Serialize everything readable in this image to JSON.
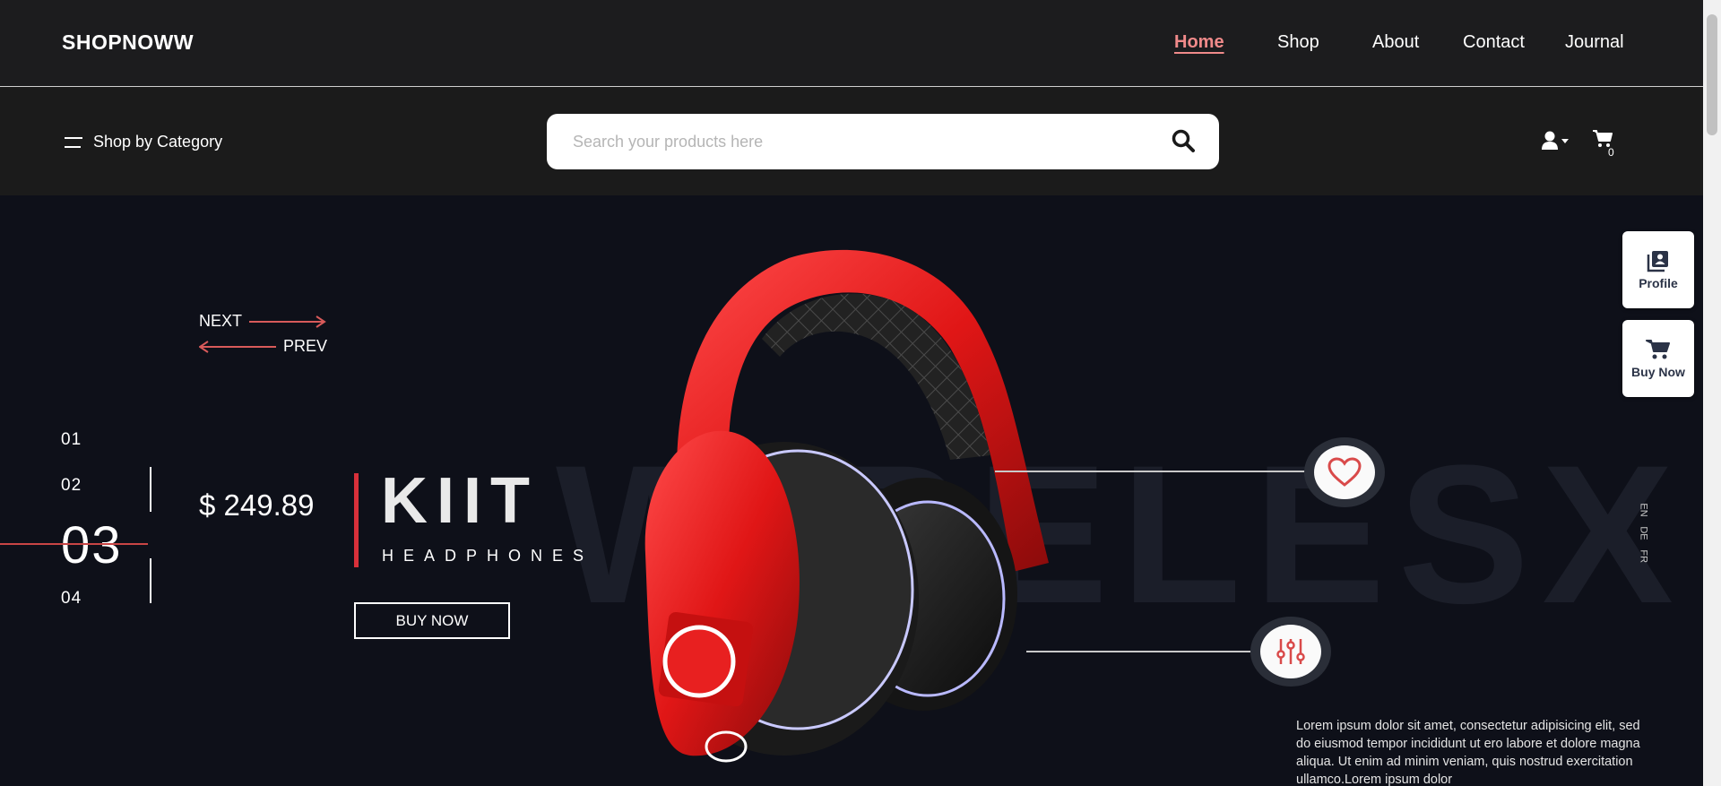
{
  "header": {
    "logo": "SHOPNOWW",
    "nav": [
      {
        "label": "Home",
        "active": true
      },
      {
        "label": "Shop",
        "active": false
      },
      {
        "label": "About",
        "active": false
      },
      {
        "label": "Contact",
        "active": false
      },
      {
        "label": "Journal",
        "active": false
      }
    ]
  },
  "subheader": {
    "category_label": "Shop by Category",
    "search_placeholder": "Search your products here",
    "cart_count": "0"
  },
  "hero": {
    "background_word": "WIRELESX",
    "next_label": "NEXT",
    "prev_label": "PREV",
    "slides": [
      "01",
      "02",
      "03",
      "04"
    ],
    "active_slide": "03",
    "price": "$ 249.89",
    "title": "KIIT",
    "subtitle": "HEADPHONES",
    "buy_button": "BUY NOW",
    "languages": [
      "EN",
      "DE",
      "FR"
    ],
    "description": "Lorem ipsum dolor sit amet, consectetur adipisicing elit, sed do eiusmod tempor incididunt ut ero labore et dolore magna aliqua. Ut enim ad minim veniam, quis nostrud exercitation ullamco.Lorem ipsum dolor",
    "accent_color": "#d8303a"
  },
  "floating": {
    "profile_label": "Profile",
    "buy_now_label": "Buy Now"
  }
}
